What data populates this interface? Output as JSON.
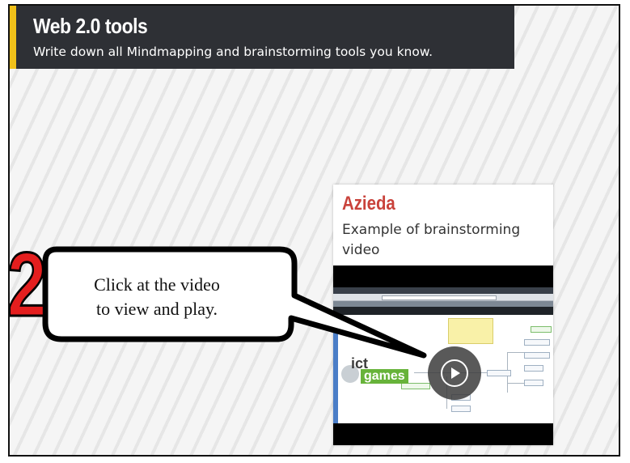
{
  "header": {
    "title": "Web 2.0 tools",
    "subtitle": "Write down all Mindmapping and brainstorming tools you know."
  },
  "card": {
    "title": "Azieda",
    "description": "Example of brainstorming video"
  },
  "video": {
    "logo_line1": "ict",
    "logo_line2": "games",
    "play_icon": "play-icon"
  },
  "callout": {
    "step_number": "2",
    "text_line1": "Click at the video",
    "text_line2": "to view and play."
  },
  "colors": {
    "header_bg": "#2e3035",
    "header_accent": "#f1c11a",
    "card_title": "#c9423b",
    "step_number": "#e41e1e"
  }
}
